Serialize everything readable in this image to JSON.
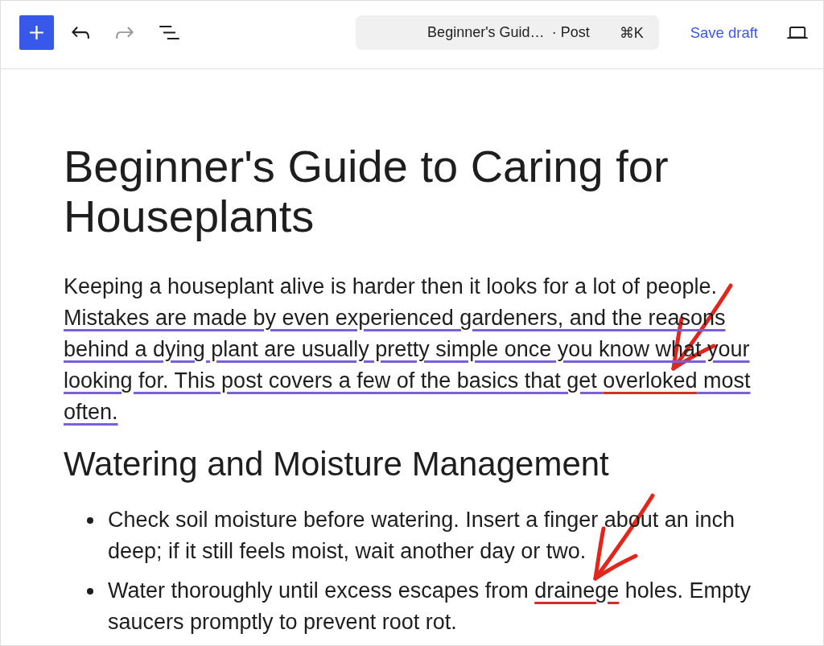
{
  "toolbar": {
    "undo": {
      "disabled": false
    },
    "redo": {
      "disabled": true
    },
    "document_bar": {
      "title": "Beginner's Guid…",
      "post_type": "· Post",
      "shortcut": "⌘K"
    },
    "save_draft": "Save draft"
  },
  "post": {
    "title": "Beginner's Guide to Caring for Houseplants",
    "blocks": [
      {
        "kind": "paragraph",
        "segments": [
          {
            "kind": "plain",
            "text": "Keeping a houseplant alive is harder then it looks for a lot of people. ",
            "annotated": false
          },
          {
            "kind": "grammar",
            "text": "Mistakes are made by even experienced gardeners, and the reasons behind a dying plant are usually pretty simple once you know what your looking for. This post covers a few of the basics that get ",
            "annotated": false
          },
          {
            "kind": "spelling",
            "text": "overloked",
            "annotated": true
          },
          {
            "kind": "grammar",
            "text": " most often.",
            "annotated": false
          }
        ]
      },
      {
        "kind": "heading",
        "text": "Watering and Moisture Management"
      },
      {
        "kind": "list",
        "items": [
          {
            "segments": [
              {
                "kind": "plain",
                "text": "Check soil moisture before watering. Insert a finger about an inch deep; if it still feels moist, wait another day or two.",
                "annotated": false
              }
            ]
          },
          {
            "segments": [
              {
                "kind": "plain",
                "text": "Water thoroughly until excess escapes from ",
                "annotated": false
              },
              {
                "kind": "spelling",
                "text": "drainege",
                "annotated": true
              },
              {
                "kind": "plain",
                "text": " holes. Empty saucers promptly to prevent root rot.",
                "annotated": false
              }
            ]
          }
        ]
      }
    ]
  }
}
